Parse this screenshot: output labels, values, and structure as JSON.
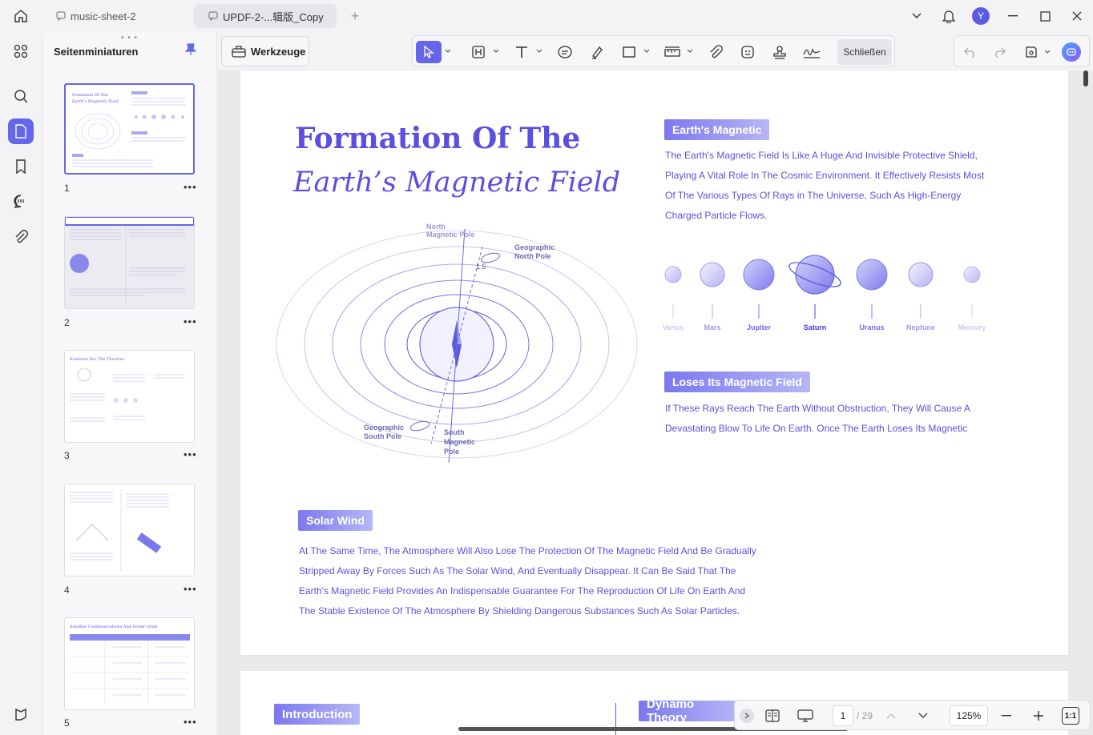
{
  "tabs": [
    {
      "label": "music-sheet-2"
    },
    {
      "label": "UPDF-2-...辑版_Copy"
    }
  ],
  "user": {
    "initial": "Y"
  },
  "sidebar": {
    "title": "Seitenminiaturen",
    "pages": [
      "1",
      "2",
      "3",
      "4",
      "5"
    ]
  },
  "toolbar": {
    "tools_label": "Werkzeuge",
    "close_label": "Schließen"
  },
  "page": {
    "title_line1": "Formation Of The",
    "title_line2": "Earth’s Magnetic Field",
    "sec1_heading": "Earth's Magnetic",
    "sec1_lines": [
      "The Earth's Magnetic Field Is Like A Huge And Invisible Protective Shield,",
      "Playing A Vital Role In The Cosmic Environment. It Effectively Resists Most",
      "Of The Various Types Of Rays in The Universe, Such As High-Energy",
      "Charged Particle Flows."
    ],
    "planets": [
      "Venus",
      "Mars",
      "Jupiter",
      "Saturn",
      "Uranus",
      "Neptune",
      "Mercury"
    ],
    "diagram": {
      "north_mag": [
        "North",
        "Magnetic Pole"
      ],
      "geo_north": [
        "Geographic",
        "North Pole"
      ],
      "angle": "1.5",
      "geo_south": [
        "Geographic",
        "South Pole"
      ],
      "south_mag": [
        "South",
        "Magnetic",
        "Pole"
      ]
    },
    "sec2_heading": "Loses Its Magnetic Field",
    "sec2_lines": [
      "If These Rays Reach The Earth Without Obstruction, They Will Cause A",
      "Devastating Blow To Life On Earth. Once The Earth Loses Its Magnetic"
    ],
    "sec3_heading": "Solar Wind",
    "sec3_lines": [
      "At The Same Time, The Atmosphere Will Also Lose The Protection Of The Magnetic Field And Be Gradually",
      "Stripped Away By Forces Such As The Solar Wind, And Eventually Disappear. It Can Be Said That The",
      "Earth's Magnetic Field Provides An Indispensable Guarantee For The Reproduction Of Life On Earth And",
      "The Stable Existence Of The Atmosphere By Shielding Dangerous Substances Such As Solar Particles."
    ],
    "p2_intro": "Introduction",
    "p2_dynamo": "Dynamo Theory"
  },
  "thumbs": {
    "t3_title": "Evidence For The Theories",
    "t5_title": "Satellite Communications And Power Grids"
  },
  "bottom": {
    "page_current": "1",
    "page_total": "/ 29",
    "zoom": "125%",
    "fit": "1:1"
  }
}
